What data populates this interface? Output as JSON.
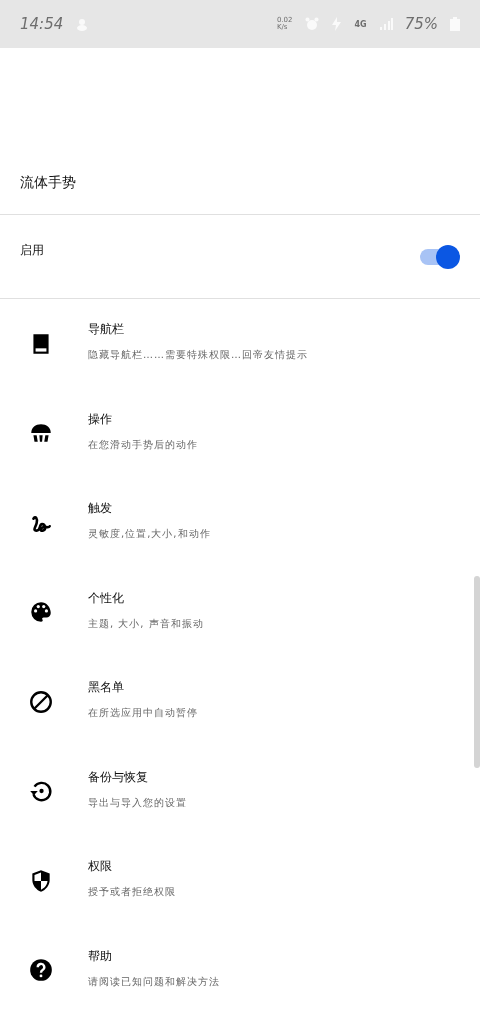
{
  "status_bar": {
    "time": "14:54",
    "speed": "0.02\nK/s",
    "network": "4G",
    "battery": "75%"
  },
  "header": {
    "title": "流体手势"
  },
  "enable": {
    "label": "启用",
    "on": true
  },
  "items": [
    {
      "kind": "navbar",
      "title": "导航栏",
      "subtitle": "隐藏导航栏……需要特殊权限…回帝友情提示"
    },
    {
      "kind": "action",
      "title": "操作",
      "subtitle": "在您滑动手势后的动作"
    },
    {
      "kind": "trigger",
      "title": "触发",
      "subtitle": "灵敏度,位置,大小,和动作"
    },
    {
      "kind": "palette",
      "title": "个性化",
      "subtitle": "主题, 大小, 声音和振动"
    },
    {
      "kind": "block",
      "title": "黑名单",
      "subtitle": "在所选应用中自动暂停"
    },
    {
      "kind": "restore",
      "title": "备份与恢复",
      "subtitle": "导出与导入您的设置"
    },
    {
      "kind": "shield",
      "title": "权限",
      "subtitle": "授予或者拒绝权限"
    },
    {
      "kind": "help",
      "title": "帮助",
      "subtitle": "请阅读已知问题和解决方法"
    }
  ]
}
